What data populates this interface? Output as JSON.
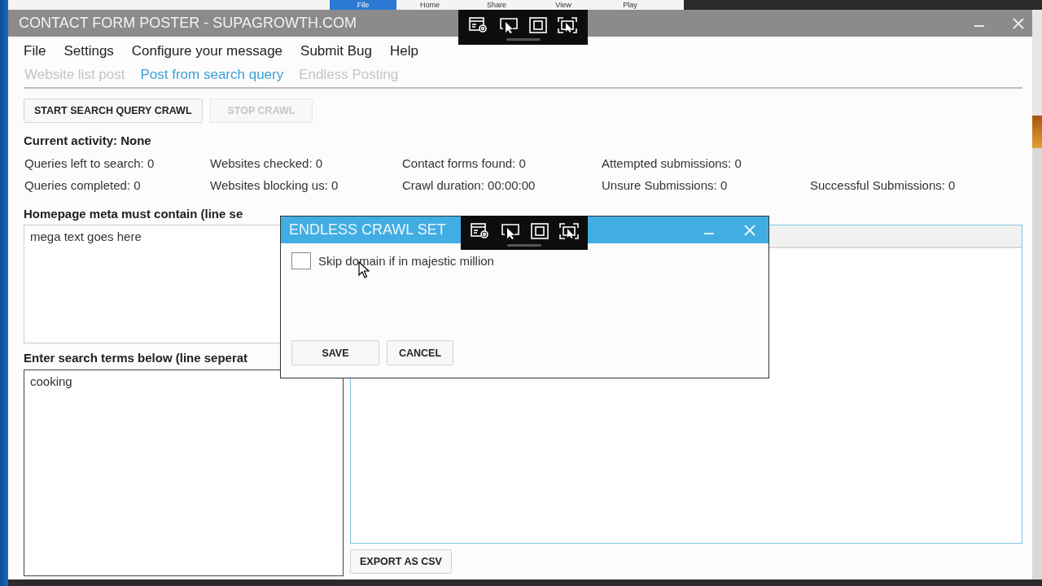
{
  "background_app": {
    "tabs": [
      {
        "label": "File",
        "selected": true
      },
      {
        "label": "Home",
        "selected": false
      },
      {
        "label": "Share",
        "selected": false
      },
      {
        "label": "View",
        "selected": false
      },
      {
        "label": "Play",
        "selected": false
      }
    ]
  },
  "window": {
    "title": "CONTACT FORM POSTER - SUPAGROWTH.COM"
  },
  "menu": [
    "File",
    "Settings",
    "Configure your message",
    "Submit Bug",
    "Help"
  ],
  "tabs": [
    {
      "label": "Website list post",
      "selected": false
    },
    {
      "label": "Post from search query",
      "selected": true
    },
    {
      "label": "Endless Posting",
      "selected": false
    }
  ],
  "buttons": [
    {
      "label": "START SEARCH QUERY CRAWL",
      "disabled": false
    },
    {
      "label": "STOP CRAWL",
      "disabled": true
    }
  ],
  "current_activity": "Current activity: None",
  "stats": [
    [
      "Queries left to search: 0",
      "Websites checked: 0",
      "Contact forms found: 0",
      "Attempted submissions: 0"
    ],
    [
      "Queries completed: 0",
      "Websites blocking us: 0",
      "Crawl duration: 00:00:00",
      "Unsure Submissions: 0",
      "Successful Submissions: 0"
    ]
  ],
  "meta_field": {
    "label": "Homepage meta must contain (line se",
    "value": "mega text goes here"
  },
  "search_field": {
    "label": "Enter search terms below (line seperat",
    "value": "cooking"
  },
  "results": {
    "export_button": "EXPORT AS CSV"
  },
  "dialog": {
    "title": "ENDLESS CRAWL SET",
    "options": [
      {
        "label": "Skip domain if in majestic million",
        "checked": false
      }
    ],
    "buttons": [
      "SAVE",
      "CANCEL"
    ]
  }
}
